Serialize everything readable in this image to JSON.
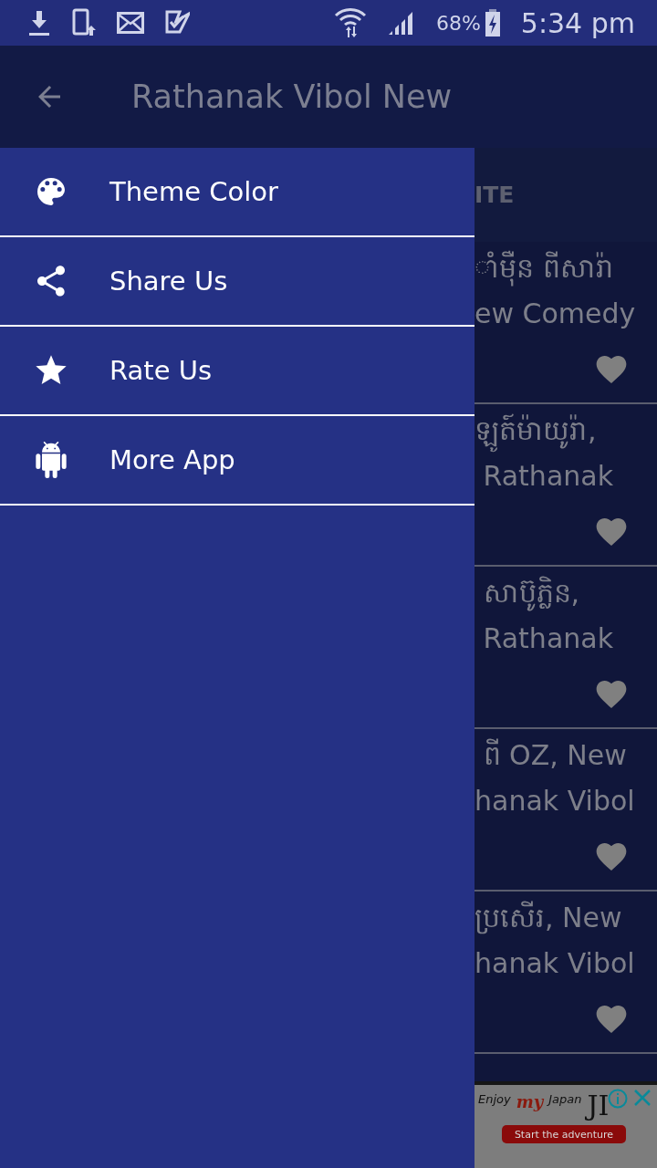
{
  "status_bar": {
    "battery": "68%",
    "time": "5:34 pm"
  },
  "app_bar": {
    "title": "Rathanak Vibol New"
  },
  "tab_strip": {
    "label": "ITE"
  },
  "drawer": {
    "items": [
      {
        "kind": "palette",
        "label": "Theme Color"
      },
      {
        "kind": "share",
        "label": "Share Us"
      },
      {
        "kind": "star",
        "label": "Rate Us"
      },
      {
        "kind": "android",
        "label": "More App"
      }
    ]
  },
  "list": {
    "rows": [
      {
        "line_1": "ាំម៉ឺន ពីសារ៉ា",
        "line_2": "ew Comedy"
      },
      {
        "line_1": "ឡូត៍ម៉ាយូរ៉ា,",
        "line_2": " Rathanak"
      },
      {
        "line_1": " សាប៊ូភ្លិន,",
        "line_2": " Rathanak"
      },
      {
        "line_1": " ពី OZ, New",
        "line_2": "hanak Vibol"
      },
      {
        "line_1": "ប្រសើរ, New",
        "line_2": "hanak Vibol"
      }
    ]
  },
  "ad": {
    "enjoy": "Enjoy",
    "my": "my",
    "japan": "Japan",
    "brand": "JI",
    "button": "Start the adventure"
  }
}
